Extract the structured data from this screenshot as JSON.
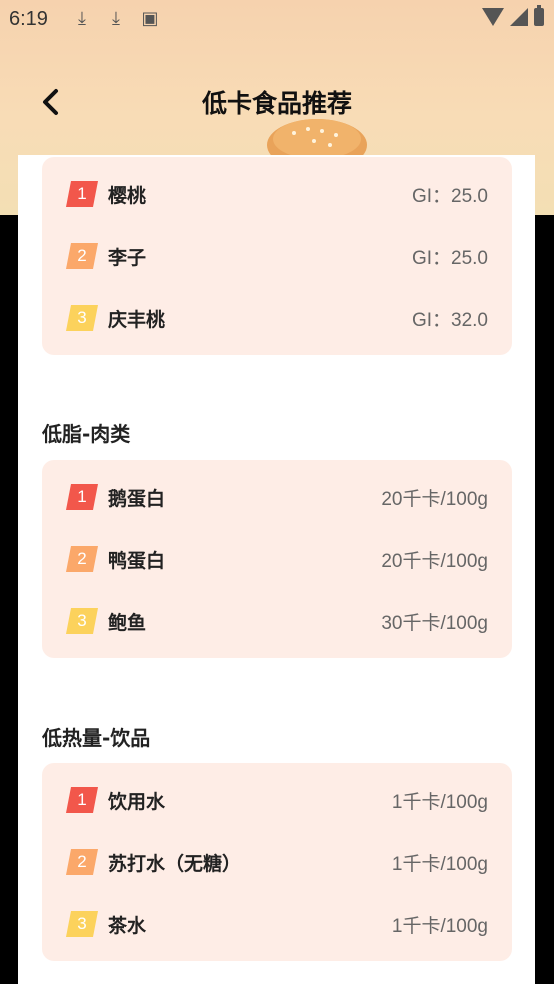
{
  "status": {
    "time": "6:19"
  },
  "header": {
    "title": "低卡食品推荐"
  },
  "colors": {
    "rank1": "#f2574b",
    "rank2": "#fba86a",
    "rank3": "#fcd25c",
    "card_bg": "#feede6"
  },
  "sections": [
    {
      "title": "",
      "items": [
        {
          "rank": "1",
          "name": "樱桃",
          "value": "GI：25.0"
        },
        {
          "rank": "2",
          "name": "李子",
          "value": "GI：25.0"
        },
        {
          "rank": "3",
          "name": "庆丰桃",
          "value": "GI：32.0"
        }
      ]
    },
    {
      "title": "低脂-肉类",
      "items": [
        {
          "rank": "1",
          "name": "鹅蛋白",
          "value": "20千卡/100g"
        },
        {
          "rank": "2",
          "name": "鸭蛋白",
          "value": "20千卡/100g"
        },
        {
          "rank": "3",
          "name": "鲍鱼",
          "value": "30千卡/100g"
        }
      ]
    },
    {
      "title": "低热量-饮品",
      "items": [
        {
          "rank": "1",
          "name": "饮用水",
          "value": "1千卡/100g"
        },
        {
          "rank": "2",
          "name": "苏打水（无糖）",
          "value": "1千卡/100g"
        },
        {
          "rank": "3",
          "name": "茶水",
          "value": "1千卡/100g"
        }
      ]
    }
  ]
}
